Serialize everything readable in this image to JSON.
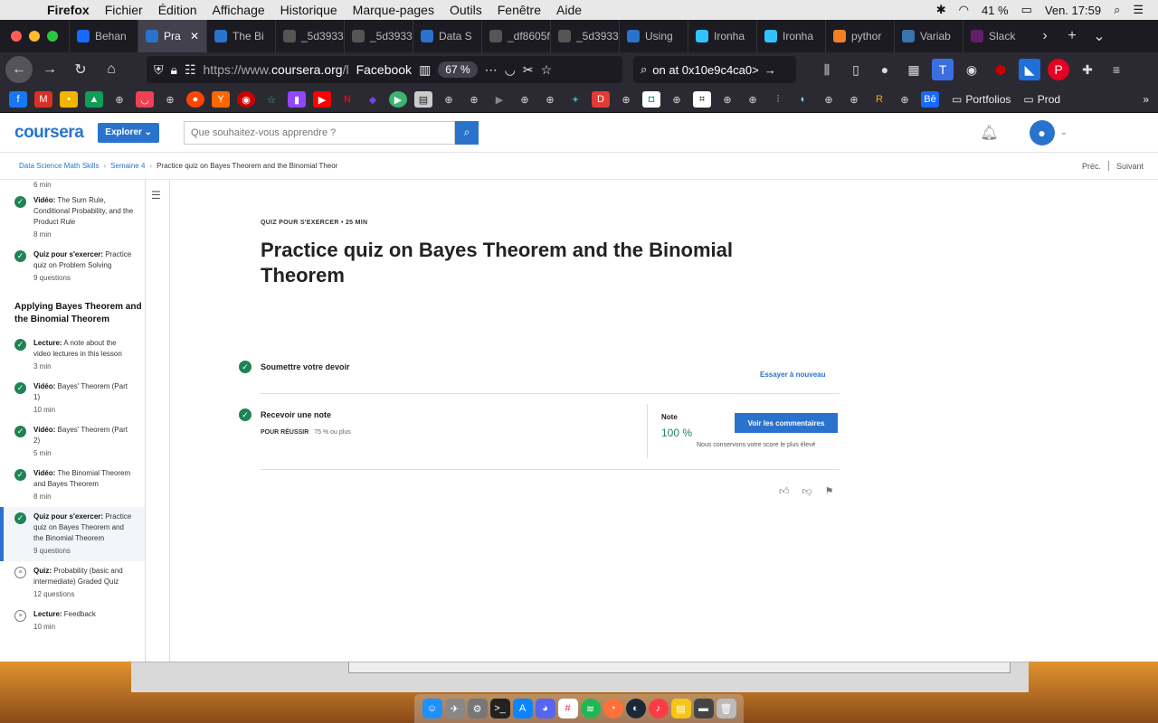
{
  "menubar": {
    "app": "Firefox",
    "items": [
      "Fichier",
      "Édition",
      "Affichage",
      "Historique",
      "Marque-pages",
      "Outils",
      "Fenêtre",
      "Aide"
    ],
    "battery": "41 %",
    "clock": "Ven. 17:59"
  },
  "tabs": [
    {
      "label": "Behan",
      "icon": "chevron-left-icon",
      "color": "#1769ff"
    },
    {
      "label": "Pra",
      "icon": "coursera-icon",
      "color": "#2a73cc",
      "active": true
    },
    {
      "label": "The Bi",
      "icon": "coursera-icon",
      "color": "#2a73cc"
    },
    {
      "label": "_5d3933c",
      "icon": "blank-icon",
      "color": "#555555"
    },
    {
      "label": "_5d3933c",
      "icon": "blank-icon",
      "color": "#555555"
    },
    {
      "label": "Data S",
      "icon": "coursera-icon",
      "color": "#2a73cc"
    },
    {
      "label": "_df8605f2",
      "icon": "blank-icon",
      "color": "#555555"
    },
    {
      "label": "_5d3933c",
      "icon": "blank-icon",
      "color": "#555555"
    },
    {
      "label": "Using",
      "icon": "coursera-icon",
      "color": "#2a73cc"
    },
    {
      "label": "Ironha",
      "icon": "ironhack-icon",
      "color": "#32c3ff"
    },
    {
      "label": "Ironha",
      "icon": "ironhack-icon",
      "color": "#32c3ff"
    },
    {
      "label": "pythor",
      "icon": "stackoverflow-icon",
      "color": "#f48024"
    },
    {
      "label": "Variab",
      "icon": "python-icon",
      "color": "#3776ab"
    },
    {
      "label": "Slack",
      "icon": "slack-icon",
      "color": "#611f69"
    }
  ],
  "nav": {
    "url_prefix": "https://www.",
    "url_domain": "coursera.org",
    "url_suffix": "/l",
    "facebook": "Facebook",
    "zoom": "67 %",
    "search_text": "on at 0x10e9c4ca0>"
  },
  "bookmarks": {
    "folders": [
      "Portfolios",
      "Prod"
    ]
  },
  "coursera": {
    "logo": "coursera",
    "explore": "Explorer",
    "search_placeholder": "Que souhaitez-vous apprendre ?"
  },
  "breadcrumb": {
    "items": [
      "Data Science Math Skills",
      "Semaine 4"
    ],
    "current": "Practice quiz on Bayes Theorem and the Binomial Theor",
    "prev": "Préc.",
    "next": "Suivant"
  },
  "sidebar": {
    "top_meta": "6  min",
    "items_before": [
      {
        "kind": "Vidéo:",
        "title": "The Sum Rule, Conditional Probability, and the Product Rule",
        "meta": "8  min"
      },
      {
        "kind": "Quiz pour s'exercer:",
        "title": "Practice quiz on Problem Solving",
        "meta": "9 questions"
      }
    ],
    "section_title": "Applying Bayes Theorem and the Binomial Theorem",
    "items_after": [
      {
        "kind": "Lecture:",
        "title": "A note about the video lectures in this lesson",
        "meta": "3  min"
      },
      {
        "kind": "Vidéo:",
        "title": "Bayes' Theorem (Part 1)",
        "meta": "10  min"
      },
      {
        "kind": "Vidéo:",
        "title": "Bayes' Theorem (Part 2)",
        "meta": "5  min"
      },
      {
        "kind": "Vidéo:",
        "title": "The Binomial Theorem and Bayes Theorem",
        "meta": "8  min"
      },
      {
        "kind": "Quiz pour s'exercer:",
        "title": "Practice quiz on Bayes Theorem and the Binomial Theorem",
        "meta": "9 questions",
        "active": true
      },
      {
        "kind": "Quiz:",
        "title": "Probability (basic and intermediate) Graded Quiz",
        "meta": "12 questions",
        "done": false
      },
      {
        "kind": "Lecture:",
        "title": "Feedback",
        "meta": "10  min",
        "done": false
      }
    ]
  },
  "quiz": {
    "kicker": "QUIZ POUR S'EXERCER • 25  MIN",
    "title": "Practice quiz on Bayes Theorem and the Binomial Theorem",
    "step1_label": "Soumettre votre devoir",
    "retry": "Essayer à nouveau",
    "step2_label": "Recevoir une note",
    "pass_label": "POUR RÉUSSIR",
    "pass_value": "75 % ou plus",
    "note_label": "Note",
    "note_value": "100 %",
    "feedback_button": "Voir les commentaires",
    "keep_note": "Nous conservons votre score le plus élevé"
  },
  "colors": {
    "brand_blue": "#2a73cc",
    "success_green": "#1f8354"
  }
}
